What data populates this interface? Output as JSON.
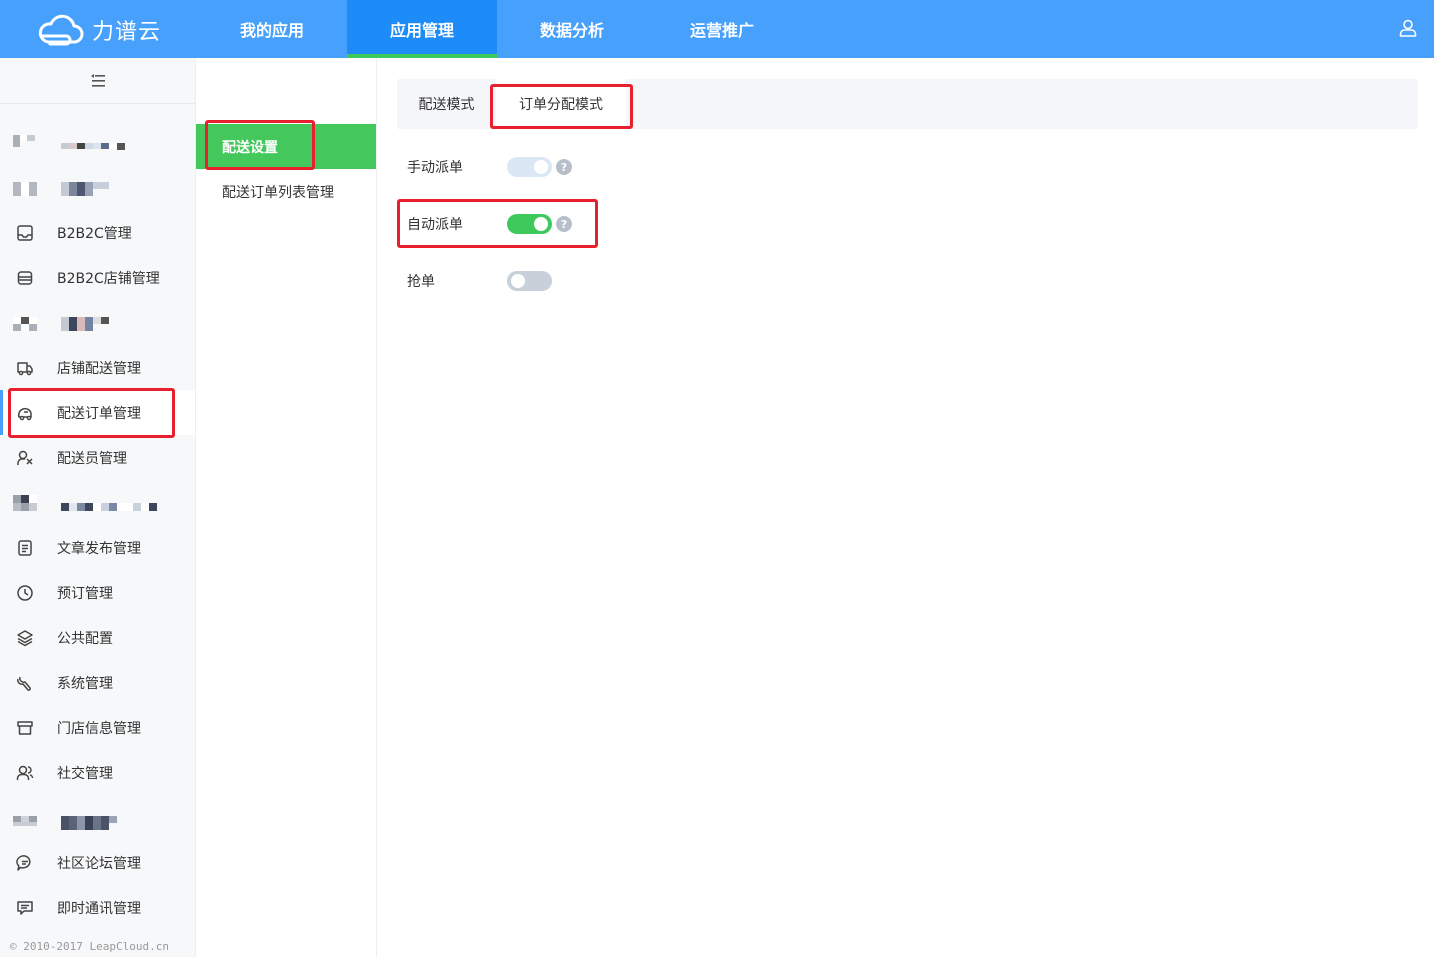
{
  "header": {
    "logo_text": "力谱云",
    "nav": [
      {
        "label": "我的应用"
      },
      {
        "label": "应用管理"
      },
      {
        "label": "数据分析"
      },
      {
        "label": "运营推广"
      }
    ],
    "active_nav_index": 1
  },
  "sidebar": {
    "items": [
      {
        "label": "B2B2C管理",
        "icon": "b2b2c-icon"
      },
      {
        "label": "B2B2C店铺管理",
        "icon": "store-icon"
      },
      {
        "label": "店铺配送管理",
        "icon": "truck-icon"
      },
      {
        "label": "配送订单管理",
        "icon": "delivery-order-icon"
      },
      {
        "label": "配送员管理",
        "icon": "courier-icon"
      },
      {
        "label": "文章发布管理",
        "icon": "document-icon"
      },
      {
        "label": "预订管理",
        "icon": "clock-icon"
      },
      {
        "label": "公共配置",
        "icon": "layers-icon"
      },
      {
        "label": "系统管理",
        "icon": "wrench-icon"
      },
      {
        "label": "门店信息管理",
        "icon": "shop-icon"
      },
      {
        "label": "社交管理",
        "icon": "users-icon"
      },
      {
        "label": "社区论坛管理",
        "icon": "forum-icon"
      },
      {
        "label": "即时通讯管理",
        "icon": "chat-icon"
      }
    ],
    "active_label": "配送订单管理",
    "footer": "© 2010-2017 LeapCloud.cn"
  },
  "subnav": {
    "items": [
      {
        "label": "配送设置"
      },
      {
        "label": "配送订单列表管理"
      }
    ],
    "active_index": 0
  },
  "main": {
    "tabs": [
      {
        "label": "配送模式"
      },
      {
        "label": "订单分配模式"
      }
    ],
    "active_tab_index": 1,
    "settings": [
      {
        "label": "手动派单",
        "state": "disabled-on",
        "help": "?"
      },
      {
        "label": "自动派单",
        "state": "on",
        "help": "?"
      },
      {
        "label": "抢单",
        "state": "off"
      }
    ]
  },
  "colors": {
    "header_bg": "#46a0fc",
    "active_nav_bg": "#1e8cf8",
    "accent_green": "#44c85c",
    "highlight_red": "#e8202e"
  }
}
